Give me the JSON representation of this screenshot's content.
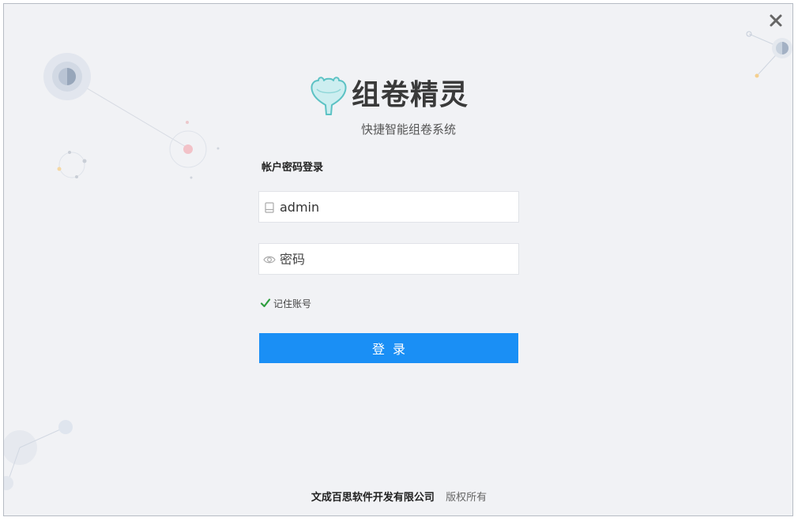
{
  "app": {
    "title": "组卷精灵",
    "subtitle": "快捷智能组卷系统"
  },
  "login": {
    "heading": "帐户密码登录",
    "username_value": "admin",
    "password_placeholder": "密码",
    "remember_label": "记住账号",
    "remember_checked": true,
    "submit_label": "登录"
  },
  "footer": {
    "company": "文成百思软件开发有限公司",
    "rights": "版权所有"
  },
  "colors": {
    "accent": "#1a8ff5",
    "background": "#f1f2f5",
    "check": "#2e9e3e",
    "logo_fill": "#cdeef0",
    "logo_stroke": "#5cc2c4"
  },
  "icons": {
    "close": "close-icon",
    "logo": "app-logo-icon",
    "username": "user-account-icon",
    "password": "eye-icon",
    "remember": "checkmark-icon"
  }
}
